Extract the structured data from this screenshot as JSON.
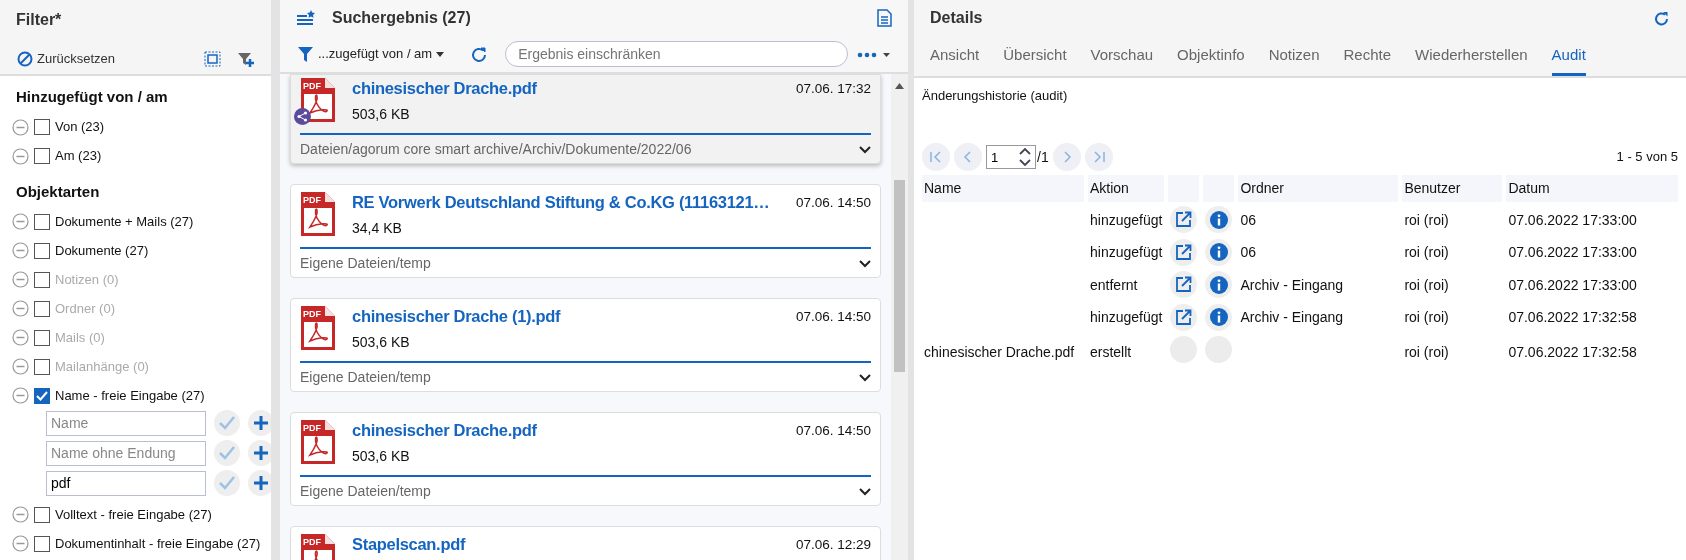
{
  "filter_panel": {
    "title": "Filter*",
    "reset_label": "Zurücksetzen",
    "groups": [
      {
        "title": "Hinzugefügt von / am",
        "items": [
          {
            "label": "Von (23)",
            "checked": false,
            "disabled": false
          },
          {
            "label": "Am (23)",
            "checked": false,
            "disabled": false
          }
        ]
      },
      {
        "title": "Objektarten",
        "items": [
          {
            "label": "Dokumente + Mails (27)",
            "checked": false,
            "disabled": false
          },
          {
            "label": "Dokumente (27)",
            "checked": false,
            "disabled": false
          },
          {
            "label": "Notizen (0)",
            "checked": false,
            "disabled": true
          },
          {
            "label": "Ordner (0)",
            "checked": false,
            "disabled": true
          },
          {
            "label": "Mails (0)",
            "checked": false,
            "disabled": true
          },
          {
            "label": "Mailanhänge (0)",
            "checked": false,
            "disabled": true
          },
          {
            "label": "Name - freie Eingabe (27)",
            "checked": true,
            "disabled": false,
            "inputs": [
              {
                "placeholder": "Name"
              },
              {
                "placeholder": "Name ohne Endung"
              },
              {
                "value": "pdf"
              }
            ]
          },
          {
            "label": "Volltext - freie Eingabe (27)",
            "checked": false,
            "disabled": false
          },
          {
            "label": "Dokumentinhalt - freie Eingabe (27)",
            "checked": false,
            "disabled": false
          }
        ]
      }
    ]
  },
  "results_panel": {
    "title": "Suchergebnis (27)",
    "filter_label": "...zugefügt von / am",
    "search": {
      "placeholder": "Ergebnis einschränken"
    },
    "items": [
      {
        "type_label": "PDF",
        "name": "chinesischer Drache.pdf",
        "date": "07.06. 17:32",
        "size": "503,6 KB",
        "path": "Dateien/agorum core smart archive/Archiv/Dokumente/2022/06",
        "selected": true,
        "shared": true
      },
      {
        "type_label": "PDF",
        "name": "RE Vorwerk Deutschland Stiftung & Co.KG (11163121…",
        "date": "07.06. 14:50",
        "size": "34,4 KB",
        "path": "Eigene Dateien/temp",
        "selected": false,
        "shared": false
      },
      {
        "type_label": "PDF",
        "name": "chinesischer Drache (1).pdf",
        "date": "07.06. 14:50",
        "size": "503,6 KB",
        "path": "Eigene Dateien/temp",
        "selected": false,
        "shared": false
      },
      {
        "type_label": "PDF",
        "name": "chinesischer Drache.pdf",
        "date": "07.06. 14:50",
        "size": "503,6 KB",
        "path": "Eigene Dateien/temp",
        "selected": false,
        "shared": false
      },
      {
        "type_label": "PDF",
        "name": "Stapelscan.pdf",
        "date": "07.06. 12:29",
        "selected": false,
        "shared": false
      }
    ]
  },
  "details_panel": {
    "title": "Details",
    "tabs": [
      {
        "label": "Ansicht",
        "selected": false
      },
      {
        "label": "Übersicht",
        "selected": false
      },
      {
        "label": "Vorschau",
        "selected": false
      },
      {
        "label": "Objektinfo",
        "selected": false
      },
      {
        "label": "Notizen",
        "selected": false
      },
      {
        "label": "Rechte",
        "selected": false
      },
      {
        "label": "Wiederherstellen",
        "selected": false
      },
      {
        "label": "Audit",
        "selected": true
      }
    ],
    "heading": "Änderungshistorie (audit)",
    "pager": {
      "page": "1",
      "total": "/1",
      "range": "1 - 5 von 5"
    },
    "table": {
      "columns": [
        "Name",
        "Aktion",
        "Ordner",
        "Benutzer",
        "Datum"
      ],
      "rows": [
        {
          "action": "hinzugefügt",
          "actions_enabled": true,
          "folder": "06",
          "user": "roi (roi)",
          "date": "07.06.2022 17:33:00"
        },
        {
          "action": "hinzugefügt",
          "actions_enabled": true,
          "folder": "06",
          "user": "roi (roi)",
          "date": "07.06.2022 17:33:00"
        },
        {
          "action": "entfernt",
          "actions_enabled": true,
          "folder": "Archiv - Eingang",
          "user": "roi (roi)",
          "date": "07.06.2022 17:33:00"
        },
        {
          "action": "hinzugefügt",
          "actions_enabled": true,
          "folder": "Archiv - Eingang",
          "user": "roi (roi)",
          "date": "07.06.2022 17:32:58"
        },
        {
          "name": "chinesischer Drache.pdf",
          "action": "erstellt",
          "actions_enabled": false,
          "user": "roi (roi)",
          "date": "07.06.2022 17:32:58"
        }
      ]
    }
  }
}
